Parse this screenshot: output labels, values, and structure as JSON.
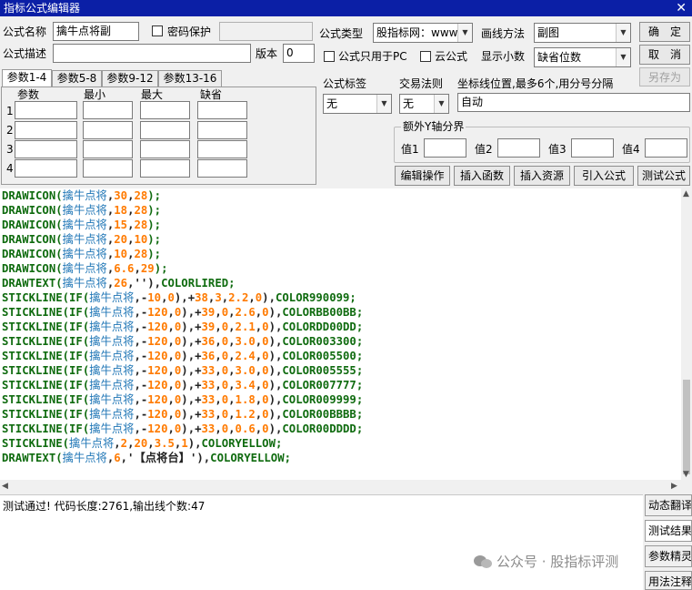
{
  "title": "指标公式编辑器",
  "close_glyph": "✕",
  "form": {
    "name_label": "公式名称",
    "name_value": "擒牛点将副",
    "password_label": "密码保护",
    "desc_label": "公式描述",
    "version_label": "版本",
    "version_value": "0",
    "type_label": "公式类型",
    "type_value": "股指标网：www",
    "draw_label": "画线方法",
    "draw_value": "副图",
    "pc_only_label": "公式只用于PC",
    "cloud_label": "云公式",
    "decimals_label": "显示小数",
    "decimals_value": "缺省位数",
    "confirm": "确　定",
    "cancel": "取　消",
    "save_as": "另存为"
  },
  "tabs": [
    "参数1-4",
    "参数5-8",
    "参数9-12",
    "参数13-16"
  ],
  "param_headers": [
    "参数",
    "最小",
    "最大",
    "缺省"
  ],
  "param_rows": [
    "1",
    "2",
    "3",
    "4"
  ],
  "labels_section": {
    "formula_tag_label": "公式标签",
    "formula_tag_value": "无",
    "trade_rule_label": "交易法则",
    "trade_rule_value": "无",
    "axis_pos_label": "坐标线位置,最多6个,用分号分隔",
    "axis_pos_value": "自动",
    "extra_y_label": "额外Y轴分界",
    "val_labels": [
      "值1",
      "值2",
      "值3",
      "值4"
    ]
  },
  "actions": {
    "edit": "编辑操作",
    "insert_func": "插入函数",
    "insert_res": "插入资源",
    "import_formula": "引入公式",
    "test_formula": "测试公式"
  },
  "code_lines": [
    [
      [
        "kw",
        "DRAWICON("
      ],
      [
        "ch",
        "擒牛点将"
      ],
      [
        "op",
        ","
      ],
      [
        "num",
        "30"
      ],
      [
        "op",
        ","
      ],
      [
        "num",
        "28"
      ],
      [
        "kw",
        ");"
      ]
    ],
    [
      [
        "kw",
        "DRAWICON("
      ],
      [
        "ch",
        "擒牛点将"
      ],
      [
        "op",
        ","
      ],
      [
        "num",
        "18"
      ],
      [
        "op",
        ","
      ],
      [
        "num",
        "28"
      ],
      [
        "kw",
        ");"
      ]
    ],
    [
      [
        "kw",
        "DRAWICON("
      ],
      [
        "ch",
        "擒牛点将"
      ],
      [
        "op",
        ","
      ],
      [
        "num",
        "15"
      ],
      [
        "op",
        ","
      ],
      [
        "num",
        "28"
      ],
      [
        "kw",
        ");"
      ]
    ],
    [
      [
        "kw",
        "DRAWICON("
      ],
      [
        "ch",
        "擒牛点将"
      ],
      [
        "op",
        ","
      ],
      [
        "num",
        "20"
      ],
      [
        "op",
        ","
      ],
      [
        "num",
        "10"
      ],
      [
        "kw",
        ");"
      ]
    ],
    [
      [
        "kw",
        "DRAWICON("
      ],
      [
        "ch",
        "擒牛点将"
      ],
      [
        "op",
        ","
      ],
      [
        "num",
        "10"
      ],
      [
        "op",
        ","
      ],
      [
        "num",
        "28"
      ],
      [
        "kw",
        ");"
      ]
    ],
    [
      [
        "kw",
        "DRAWICON("
      ],
      [
        "ch",
        "擒牛点将"
      ],
      [
        "op",
        ","
      ],
      [
        "num",
        "6.6"
      ],
      [
        "op",
        ","
      ],
      [
        "num",
        "29"
      ],
      [
        "kw",
        ");"
      ]
    ],
    [
      [
        "kw",
        "DRAWTEXT("
      ],
      [
        "ch",
        "擒牛点将"
      ],
      [
        "op",
        ","
      ],
      [
        "num",
        "26"
      ],
      [
        "op",
        ",''),"
      ],
      [
        "kw",
        "COLORLIRED;"
      ]
    ],
    [
      [
        "kw",
        "STICKLINE(IF("
      ],
      [
        "ch",
        "擒牛点将"
      ],
      [
        "op",
        ",-"
      ],
      [
        "num",
        "10"
      ],
      [
        "op",
        ","
      ],
      [
        "num",
        "0"
      ],
      [
        "op",
        "),+"
      ],
      [
        "num",
        "38"
      ],
      [
        "op",
        ","
      ],
      [
        "num",
        "3"
      ],
      [
        "op",
        ","
      ],
      [
        "num",
        "2.2"
      ],
      [
        "op",
        ","
      ],
      [
        "num",
        "0"
      ],
      [
        "op",
        "),"
      ],
      [
        "kw",
        "COLOR990099;"
      ]
    ],
    [
      [
        "kw",
        "STICKLINE(IF("
      ],
      [
        "ch",
        "擒牛点将"
      ],
      [
        "op",
        ",-"
      ],
      [
        "num",
        "120"
      ],
      [
        "op",
        ","
      ],
      [
        "num",
        "0"
      ],
      [
        "op",
        "),+"
      ],
      [
        "num",
        "39"
      ],
      [
        "op",
        ","
      ],
      [
        "num",
        "0"
      ],
      [
        "op",
        ","
      ],
      [
        "num",
        "2.6"
      ],
      [
        "op",
        ","
      ],
      [
        "num",
        "0"
      ],
      [
        "op",
        "),"
      ],
      [
        "kw",
        "COLORBB00BB;"
      ]
    ],
    [
      [
        "kw",
        "STICKLINE(IF("
      ],
      [
        "ch",
        "擒牛点将"
      ],
      [
        "op",
        ",-"
      ],
      [
        "num",
        "120"
      ],
      [
        "op",
        ","
      ],
      [
        "num",
        "0"
      ],
      [
        "op",
        "),+"
      ],
      [
        "num",
        "39"
      ],
      [
        "op",
        ","
      ],
      [
        "num",
        "0"
      ],
      [
        "op",
        ","
      ],
      [
        "num",
        "2.1"
      ],
      [
        "op",
        ","
      ],
      [
        "num",
        "0"
      ],
      [
        "op",
        "),"
      ],
      [
        "kw",
        "COLORDD00DD;"
      ]
    ],
    [
      [
        "kw",
        "STICKLINE(IF("
      ],
      [
        "ch",
        "擒牛点将"
      ],
      [
        "op",
        ",-"
      ],
      [
        "num",
        "120"
      ],
      [
        "op",
        ","
      ],
      [
        "num",
        "0"
      ],
      [
        "op",
        "),+"
      ],
      [
        "num",
        "36"
      ],
      [
        "op",
        ","
      ],
      [
        "num",
        "0"
      ],
      [
        "op",
        ","
      ],
      [
        "num",
        "3.0"
      ],
      [
        "op",
        ","
      ],
      [
        "num",
        "0"
      ],
      [
        "op",
        "),"
      ],
      [
        "kw",
        "COLOR003300;"
      ]
    ],
    [
      [
        "kw",
        "STICKLINE(IF("
      ],
      [
        "ch",
        "擒牛点将"
      ],
      [
        "op",
        ",-"
      ],
      [
        "num",
        "120"
      ],
      [
        "op",
        ","
      ],
      [
        "num",
        "0"
      ],
      [
        "op",
        "),+"
      ],
      [
        "num",
        "36"
      ],
      [
        "op",
        ","
      ],
      [
        "num",
        "0"
      ],
      [
        "op",
        ","
      ],
      [
        "num",
        "2.4"
      ],
      [
        "op",
        ","
      ],
      [
        "num",
        "0"
      ],
      [
        "op",
        "),"
      ],
      [
        "kw",
        "COLOR005500;"
      ]
    ],
    [
      [
        "kw",
        "STICKLINE(IF("
      ],
      [
        "ch",
        "擒牛点将"
      ],
      [
        "op",
        ",-"
      ],
      [
        "num",
        "120"
      ],
      [
        "op",
        ","
      ],
      [
        "num",
        "0"
      ],
      [
        "op",
        "),+"
      ],
      [
        "num",
        "33"
      ],
      [
        "op",
        ","
      ],
      [
        "num",
        "0"
      ],
      [
        "op",
        ","
      ],
      [
        "num",
        "3.0"
      ],
      [
        "op",
        ","
      ],
      [
        "num",
        "0"
      ],
      [
        "op",
        "),"
      ],
      [
        "kw",
        "COLOR005555;"
      ]
    ],
    [
      [
        "kw",
        "STICKLINE(IF("
      ],
      [
        "ch",
        "擒牛点将"
      ],
      [
        "op",
        ",-"
      ],
      [
        "num",
        "120"
      ],
      [
        "op",
        ","
      ],
      [
        "num",
        "0"
      ],
      [
        "op",
        "),+"
      ],
      [
        "num",
        "33"
      ],
      [
        "op",
        ","
      ],
      [
        "num",
        "0"
      ],
      [
        "op",
        ","
      ],
      [
        "num",
        "3.4"
      ],
      [
        "op",
        ","
      ],
      [
        "num",
        "0"
      ],
      [
        "op",
        "),"
      ],
      [
        "kw",
        "COLOR007777;"
      ]
    ],
    [
      [
        "kw",
        "STICKLINE(IF("
      ],
      [
        "ch",
        "擒牛点将"
      ],
      [
        "op",
        ",-"
      ],
      [
        "num",
        "120"
      ],
      [
        "op",
        ","
      ],
      [
        "num",
        "0"
      ],
      [
        "op",
        "),+"
      ],
      [
        "num",
        "33"
      ],
      [
        "op",
        ","
      ],
      [
        "num",
        "0"
      ],
      [
        "op",
        ","
      ],
      [
        "num",
        "1.8"
      ],
      [
        "op",
        ","
      ],
      [
        "num",
        "0"
      ],
      [
        "op",
        "),"
      ],
      [
        "kw",
        "COLOR009999;"
      ]
    ],
    [
      [
        "kw",
        "STICKLINE(IF("
      ],
      [
        "ch",
        "擒牛点将"
      ],
      [
        "op",
        ",-"
      ],
      [
        "num",
        "120"
      ],
      [
        "op",
        ","
      ],
      [
        "num",
        "0"
      ],
      [
        "op",
        "),+"
      ],
      [
        "num",
        "33"
      ],
      [
        "op",
        ","
      ],
      [
        "num",
        "0"
      ],
      [
        "op",
        ","
      ],
      [
        "num",
        "1.2"
      ],
      [
        "op",
        ","
      ],
      [
        "num",
        "0"
      ],
      [
        "op",
        "),"
      ],
      [
        "kw",
        "COLOR00BBBB;"
      ]
    ],
    [
      [
        "kw",
        "STICKLINE(IF("
      ],
      [
        "ch",
        "擒牛点将"
      ],
      [
        "op",
        ",-"
      ],
      [
        "num",
        "120"
      ],
      [
        "op",
        ","
      ],
      [
        "num",
        "0"
      ],
      [
        "op",
        "),+"
      ],
      [
        "num",
        "33"
      ],
      [
        "op",
        ","
      ],
      [
        "num",
        "0"
      ],
      [
        "op",
        ","
      ],
      [
        "num",
        "0.6"
      ],
      [
        "op",
        ","
      ],
      [
        "num",
        "0"
      ],
      [
        "op",
        "),"
      ],
      [
        "kw",
        "COLOR00DDDD;"
      ]
    ],
    [
      [
        "kw",
        "STICKLINE("
      ],
      [
        "ch",
        "擒牛点将"
      ],
      [
        "op",
        ","
      ],
      [
        "num",
        "2"
      ],
      [
        "op",
        ","
      ],
      [
        "num",
        "20"
      ],
      [
        "op",
        ","
      ],
      [
        "num",
        "3.5"
      ],
      [
        "op",
        ","
      ],
      [
        "num",
        "1"
      ],
      [
        "op",
        "),"
      ],
      [
        "kw",
        "COLORYELLOW;"
      ]
    ],
    [
      [
        "kw",
        "DRAWTEXT("
      ],
      [
        "ch",
        "擒牛点将"
      ],
      [
        "op",
        ","
      ],
      [
        "num",
        "6"
      ],
      [
        "op",
        ",'【点将台】'),"
      ],
      [
        "kw",
        "COLORYELLOW;"
      ]
    ]
  ],
  "status_text": "测试通过! 代码长度:2761,输出线个数:47",
  "side_buttons": [
    "动态翻译",
    "测试结果",
    "参数精灵",
    "用法注释"
  ],
  "watermark": "公众号 · 股指标评测",
  "colors": {
    "title_bar": "#0b1fa6",
    "keyword": "#0f6b0f",
    "chinese_var": "#1f76b6",
    "number": "#ff7a00"
  }
}
